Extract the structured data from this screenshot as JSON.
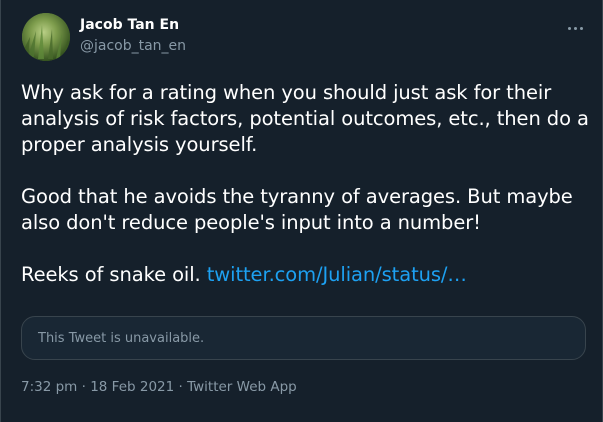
{
  "author": {
    "display_name": "Jacob Tan En",
    "handle": "@jacob_tan_en"
  },
  "tweet": {
    "paragraph_1": "Why ask for a rating when you should just ask for their analysis of risk factors, potential outcomes, etc., then do a proper analysis yourself.",
    "paragraph_2": "Good that he avoids the tyranny of averages. But maybe also don't reduce people's input into a number!",
    "paragraph_3_text": "Reeks of snake oil. ",
    "paragraph_3_link": "twitter.com/Julian/status/…"
  },
  "quoted_tweet": {
    "status": "This Tweet is unavailable."
  },
  "meta": {
    "time": "7:32 pm",
    "separator_1": " · ",
    "date": "18 Feb 2021",
    "separator_2": " · ",
    "source": "Twitter Web App"
  },
  "colors": {
    "background": "#15202b",
    "text": "#ffffff",
    "secondary_text": "#8899a6",
    "link": "#1da1f2",
    "border": "#38444d"
  },
  "icons": {
    "more": "more-horizontal-icon"
  }
}
